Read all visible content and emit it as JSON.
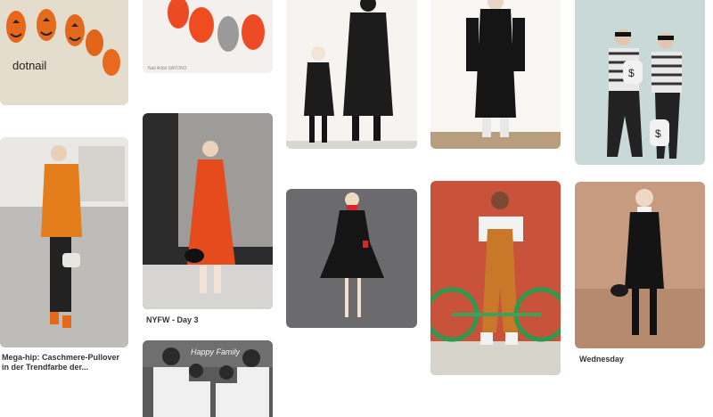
{
  "pins": [
    {
      "id": "pin-1",
      "overlay_text": "dotnail",
      "caption": null,
      "description": "orange pumpkin nail art on white mat"
    },
    {
      "id": "pin-2",
      "overlay_text": "Nail Artist SAYONO",
      "caption": null,
      "description": "orange and grey false nails"
    },
    {
      "id": "pin-3",
      "caption": null,
      "description": "mother and child in black outfits"
    },
    {
      "id": "pin-4",
      "caption": null,
      "description": "woman in long black dress"
    },
    {
      "id": "pin-5",
      "caption": null,
      "description": "couple robber costume with money bags"
    },
    {
      "id": "pin-6",
      "caption": "Mega-hip: Caschmere-Pullover in der Trendfarbe der...",
      "description": "woman in orange sweater on street"
    },
    {
      "id": "pin-7",
      "caption": "NYFW - Day 3",
      "description": "woman in orange dress with black bag"
    },
    {
      "id": "pin-8",
      "caption": null,
      "description": "black dress with red collar"
    },
    {
      "id": "pin-9",
      "caption": null,
      "description": "woman in orange overalls with bicycle"
    },
    {
      "id": "pin-10",
      "caption": "Wednesday",
      "description": "woman in black dress with white collar"
    },
    {
      "id": "pin-11",
      "overlay_text": "Happy Family",
      "caption": null,
      "description": "family in matching mickey sweaters"
    }
  ],
  "icons": {
    "dollar_sign": "$"
  }
}
